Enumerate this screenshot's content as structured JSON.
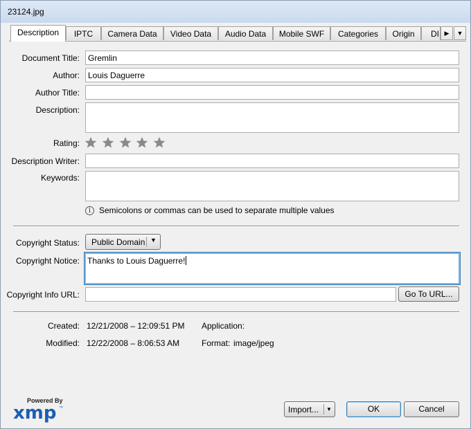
{
  "window": {
    "title": "23124.jpg"
  },
  "tabs": [
    {
      "label": "Description",
      "active": true
    },
    {
      "label": "IPTC"
    },
    {
      "label": "Camera Data"
    },
    {
      "label": "Video Data"
    },
    {
      "label": "Audio Data"
    },
    {
      "label": "Mobile SWF"
    },
    {
      "label": "Categories"
    },
    {
      "label": "Origin"
    },
    {
      "label": "DI"
    }
  ],
  "form": {
    "document_title": {
      "label": "Document Title:",
      "value": "Gremlin"
    },
    "author": {
      "label": "Author:",
      "value": "Louis Daguerre"
    },
    "author_title": {
      "label": "Author Title:",
      "value": ""
    },
    "description": {
      "label": "Description:",
      "value": ""
    },
    "rating": {
      "label": "Rating:",
      "stars": 0,
      "max": 5
    },
    "description_writer": {
      "label": "Description Writer:",
      "value": ""
    },
    "keywords": {
      "label": "Keywords:",
      "value": ""
    },
    "keywords_hint": "Semicolons or commas can be used to separate multiple values",
    "copyright_status": {
      "label": "Copyright Status:",
      "value": "Public Domain"
    },
    "copyright_notice": {
      "label": "Copyright Notice:",
      "value": "Thanks to Louis Daguerre!"
    },
    "copyright_info_url": {
      "label": "Copyright Info URL:",
      "value": ""
    },
    "go_to_url_label": "Go To URL..."
  },
  "meta": {
    "created_label": "Created:",
    "created_value": "12/21/2008 – 12:09:51 PM",
    "modified_label": "Modified:",
    "modified_value": "12/22/2008 – 8:06:53 AM",
    "application_label": "Application:",
    "application_value": "",
    "format_label": "Format:",
    "format_value": "image/jpeg"
  },
  "footer": {
    "powered_by": "Powered By",
    "logo_text": "xmp",
    "logo_tm": "™",
    "import_label": "Import...",
    "ok_label": "OK",
    "cancel_label": "Cancel"
  },
  "colors": {
    "logo_blue": "#1c5fb1",
    "focus_border": "#7eb4ea"
  }
}
